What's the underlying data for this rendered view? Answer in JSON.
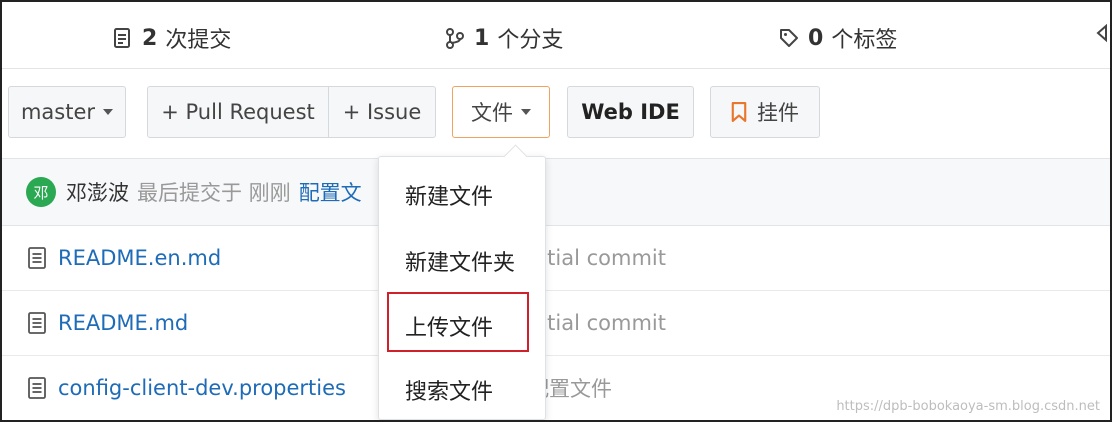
{
  "stats": {
    "commits_count": "2",
    "commits_label": "次提交",
    "branches_count": "1",
    "branches_label": "个分支",
    "tags_count": "0",
    "tags_label": "个标签"
  },
  "toolbar": {
    "branch": "master",
    "pull_request": "+ Pull Request",
    "issue": "+ Issue",
    "files": "文件",
    "web_ide": "Web IDE",
    "widget": "挂件"
  },
  "commit": {
    "avatar_text": "邓",
    "author": "邓澎波",
    "meta": "最后提交于 刚刚",
    "message": "配置文"
  },
  "files": [
    {
      "name": "README.en.md",
      "message": "nitial commit"
    },
    {
      "name": "README.md",
      "message": "nitial commit"
    },
    {
      "name": "config-client-dev.properties",
      "message": "配置文件"
    }
  ],
  "dropdown": {
    "items": [
      "新建文件",
      "新建文件夹",
      "上传文件",
      "搜索文件"
    ]
  },
  "watermark": "https://dpb-bobokaoya-sm.blog.csdn.net",
  "colors": {
    "accent_orange": "#f0a35e",
    "link": "#1e6bb8",
    "highlight_red": "#d0202a"
  }
}
